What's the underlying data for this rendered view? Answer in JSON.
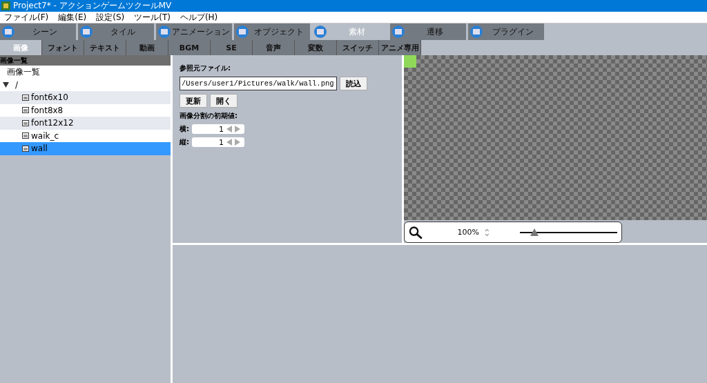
{
  "window": {
    "title": "Project7* - アクションゲームツクールMV"
  },
  "menu": [
    "ファイル(F)",
    "編集(E)",
    "設定(S)",
    "ツール(T)",
    "ヘルプ(H)"
  ],
  "main_tabs": [
    {
      "label": "シーン",
      "selected": false
    },
    {
      "label": "タイル",
      "selected": false
    },
    {
      "label": "アニメーション",
      "selected": false
    },
    {
      "label": "オブジェクト",
      "selected": false
    },
    {
      "label": "素材",
      "selected": true
    },
    {
      "label": "遷移",
      "selected": false
    },
    {
      "label": "プラグイン",
      "selected": false
    }
  ],
  "sub_tabs": [
    {
      "label": "画像",
      "selected": true
    },
    {
      "label": "フォント",
      "selected": false
    },
    {
      "label": "テキスト",
      "selected": false
    },
    {
      "label": "動画",
      "selected": false
    },
    {
      "label": "BGM",
      "selected": false
    },
    {
      "label": "SE",
      "selected": false
    },
    {
      "label": "音声",
      "selected": false
    },
    {
      "label": "変数",
      "selected": false
    },
    {
      "label": "スイッチ",
      "selected": false
    },
    {
      "label": "アニメ専用",
      "selected": false
    }
  ],
  "image_list": {
    "header": "画像一覧",
    "root_label": "画像一覧",
    "tree": [
      {
        "label": "/",
        "expanded": true,
        "children": [
          {
            "label": "font6x10",
            "selected": false
          },
          {
            "label": "font8x8",
            "selected": false
          },
          {
            "label": "font12x12",
            "selected": false
          },
          {
            "label": "waik_c",
            "selected": false
          },
          {
            "label": "wall",
            "selected": true
          }
        ]
      }
    ]
  },
  "properties": {
    "source_label": "参照元ファイル:",
    "source_value": "/Users/user1/Pictures/walk/wall.png",
    "load_button": "読込",
    "buttons": [
      "更新",
      "開く"
    ],
    "split_label": "画像分割の初期値:",
    "spinners": [
      {
        "label": "横:",
        "value": "1"
      },
      {
        "label": "縦:",
        "value": "1"
      }
    ]
  },
  "preview": {
    "zoom": "100%",
    "level": 0.15
  }
}
